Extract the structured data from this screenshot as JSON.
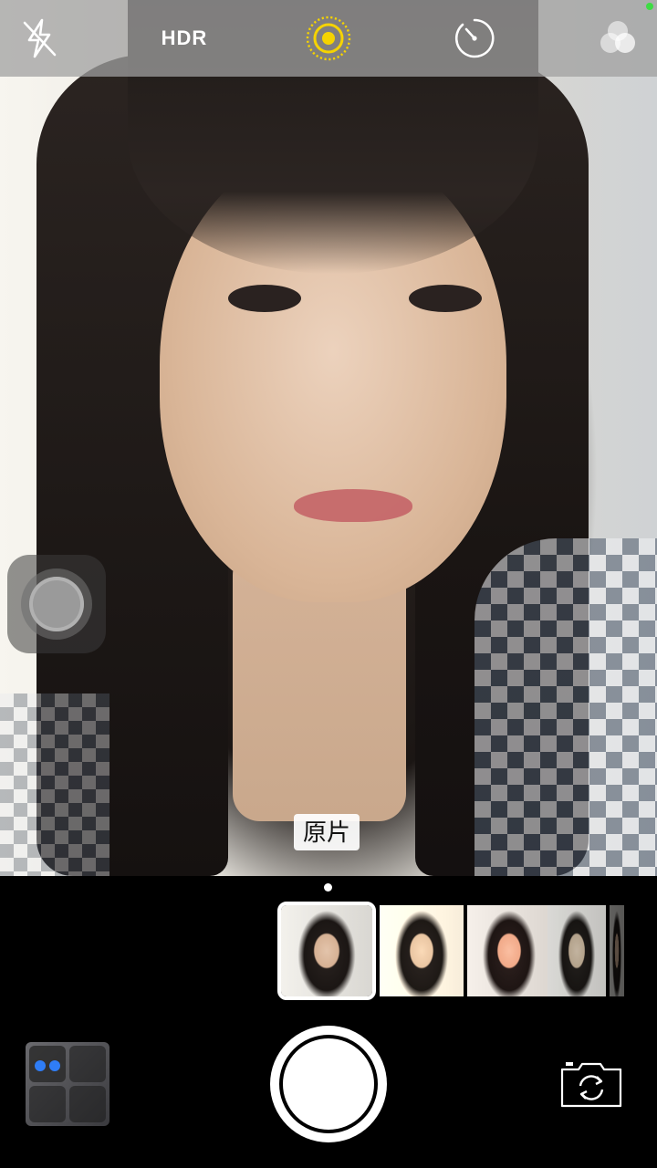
{
  "top_bar": {
    "flash": {
      "icon": "flash-off-icon",
      "state": "off"
    },
    "hdr_label": "HDR",
    "live_photo": {
      "icon": "live-photo-icon",
      "state": "on",
      "color": "#f5d300"
    },
    "timer": {
      "icon": "timer-icon"
    },
    "filters": {
      "icon": "filters-icon"
    }
  },
  "viewfinder": {
    "filter_label": "原片"
  },
  "filter_strip": {
    "selected_index": 0,
    "thumbnails": [
      "原片",
      "",
      "",
      "",
      ""
    ]
  },
  "bottom_bar": {
    "gallery_icon": "last-photo-thumbnail",
    "shutter_icon": "shutter-button",
    "switch_camera_icon": "camera-switch-icon"
  },
  "colors": {
    "accent_yellow": "#f5d300",
    "status_green": "#3ddc43"
  }
}
